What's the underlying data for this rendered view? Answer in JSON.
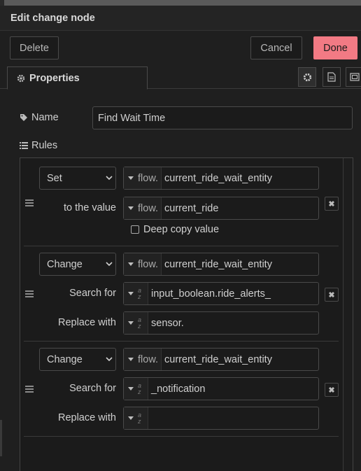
{
  "dialog": {
    "title": "Edit change node"
  },
  "toolbar": {
    "delete_label": "Delete",
    "cancel_label": "Cancel",
    "done_label": "Done",
    "done_color": "#f27a84"
  },
  "tabs": {
    "properties_label": "Properties"
  },
  "name": {
    "label": "Name",
    "value": "Find Wait Time"
  },
  "rules": {
    "label": "Rules",
    "items": [
      {
        "action": "Set",
        "target_type": "flow.",
        "target": "current_ride_wait_entity",
        "value_label": "to the value",
        "value_type": "flow.",
        "value": "current_ride",
        "deep_copy_label": "Deep copy value"
      },
      {
        "action": "Change",
        "target_type": "flow.",
        "target": "current_ride_wait_entity",
        "search_label": "Search for",
        "search_value": "input_boolean.ride_alerts_",
        "replace_label": "Replace with",
        "replace_value": "sensor."
      },
      {
        "action": "Change",
        "target_type": "flow.",
        "target": "current_ride_wait_entity",
        "search_label": "Search for",
        "search_value": "_notification",
        "replace_label": "Replace with",
        "replace_value": ""
      }
    ]
  },
  "type_icon": {
    "top": "a",
    "bottom": "z"
  }
}
